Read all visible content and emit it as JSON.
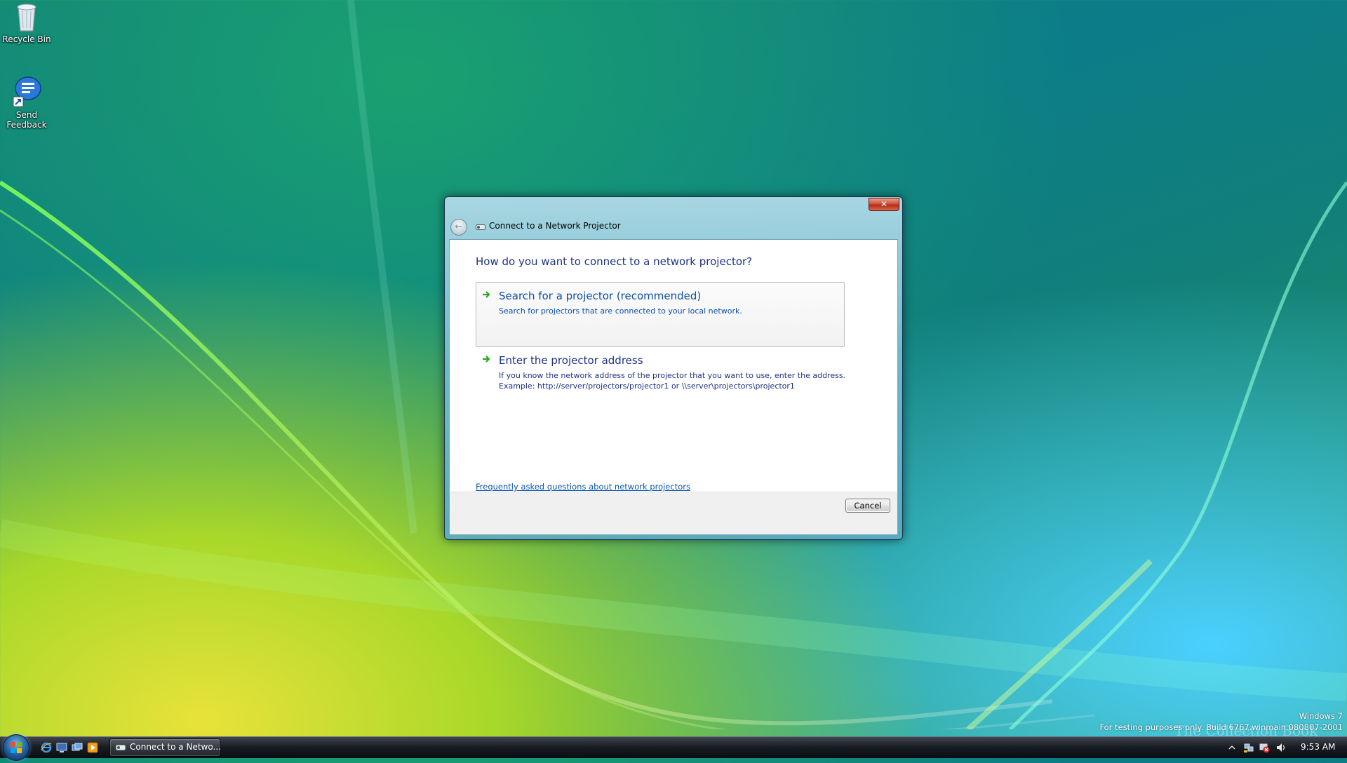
{
  "desktop": {
    "icons": [
      {
        "label": "Recycle Bin",
        "icon": "recycle-bin-icon"
      },
      {
        "label": "Send Feedback",
        "icon": "send-feedback-icon"
      }
    ]
  },
  "dialog": {
    "title": "Connect to a Network Projector",
    "close_glyph": "✕",
    "back_glyph": "←",
    "question": "How do you want to connect to a network projector?",
    "options": [
      {
        "title": "Search for a projector (recommended)",
        "description": "Search for projectors that are connected to your local network.",
        "icon": "green-arrow-icon",
        "hovered": true
      },
      {
        "title": "Enter the projector address",
        "description_line1": "If you know the network address of the projector that you want to use, enter the address.",
        "description_line2": "Example: http://server/projectors/projector1 or \\\\server\\projectors\\projector1",
        "icon": "green-arrow-icon",
        "hovered": false
      }
    ],
    "faq_link": "Frequently asked questions about network projectors",
    "cancel_label": "Cancel"
  },
  "watermark": {
    "line1": "Windows 7",
    "line2": "For testing purposes only. Build 6767.winmain.080807-2001",
    "logo_text": "The Collection Book"
  },
  "taskbar": {
    "quick_launch": [
      "internet-explorer-icon",
      "show-desktop-icon",
      "switch-windows-icon",
      "media-player-icon"
    ],
    "task_button_label": "Connect to a Netwo...",
    "tray_icons": [
      "show-hidden-icons-icon",
      "network-icon",
      "security-alert-icon",
      "volume-icon"
    ],
    "clock": "9:53 AM"
  },
  "colors": {
    "heading_blue": "#1e3287",
    "link_blue": "#0a57b4",
    "arrow_green": "#2aa81e"
  }
}
